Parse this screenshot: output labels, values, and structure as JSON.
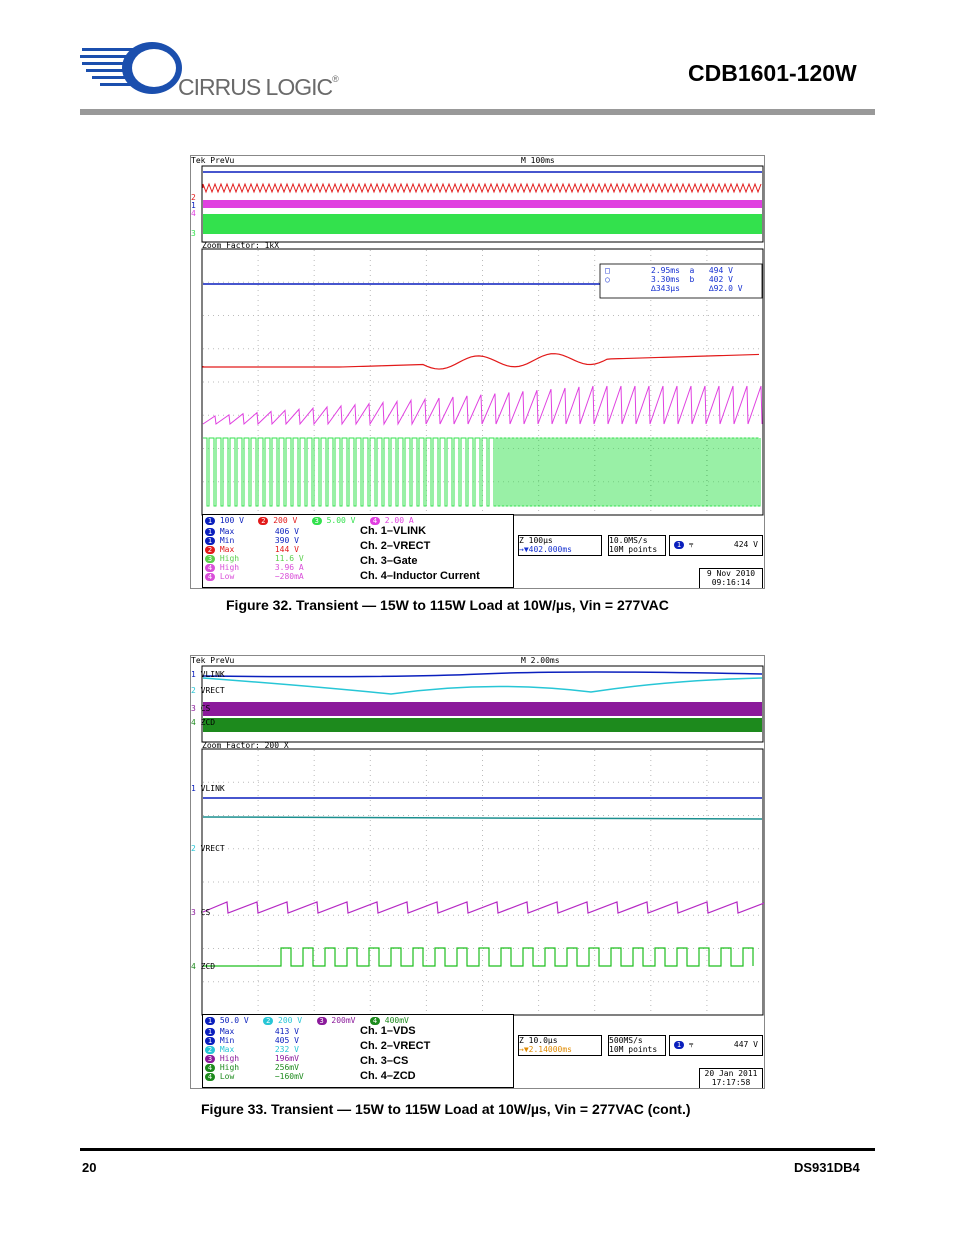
{
  "header": {
    "brand": "CIRRUS LOGIC",
    "brand_mark": "®",
    "doc_title": "CDB1601-120W"
  },
  "fig32": {
    "top_left": "Tek PreVu",
    "top_mid": "M 100ms",
    "zoom": "Zoom Factor: 1kX",
    "cursor": {
      "t1": "2.95ms",
      "t2": "3.30ms",
      "dt": "∆343µs",
      "v1": "494 V",
      "v2": "402 V",
      "dv": "∆92.0 V",
      "ma": "a",
      "mb": "b"
    },
    "ch_labels": [
      "2",
      "1",
      "4",
      "3"
    ],
    "scales": [
      "100 V",
      "200 V",
      "5.00 V",
      "2.00 A"
    ],
    "meas": [
      {
        "ch": "1",
        "name": "Max",
        "val": "406 V",
        "color": "#0a1fbd"
      },
      {
        "ch": "1",
        "name": "Min",
        "val": "390 V",
        "color": "#0a1fbd"
      },
      {
        "ch": "2",
        "name": "Max",
        "val": "144 V",
        "color": "#e21a1a"
      },
      {
        "ch": "3",
        "name": "High",
        "val": "11.6 V",
        "color": "#5ccf4d"
      },
      {
        "ch": "4",
        "name": "High",
        "val": "3.96 A",
        "color": "#d94fd9"
      },
      {
        "ch": "4",
        "name": "Low",
        "val": "−280mA",
        "color": "#d94fd9"
      }
    ],
    "legend": [
      "Ch. 1–VLINK",
      "Ch. 2–VRECT",
      "Ch. 3–Gate",
      "Ch. 4–Inductor Current"
    ],
    "zoom_box": [
      "Z 100µs",
      "→▼402.000ms"
    ],
    "rate_box": [
      "10.0MS/s",
      "10M points"
    ],
    "trig_box": [
      "1",
      "⫧",
      "424 V"
    ],
    "date": [
      "9 Nov 2010",
      "09:16:14"
    ],
    "caption": "Figure 32.  Transient — 15W to 115W Load at 10W/µs, Vin = 277VAC"
  },
  "fig33": {
    "top_left": "Tek PreVu",
    "top_mid": "M 2.00ms",
    "zoom": "Zoom Factor: 200 X",
    "ch_names": [
      "VLINK",
      "VRECT",
      "CS",
      "ZCD"
    ],
    "ch_nums": [
      "1",
      "2",
      "3",
      "4"
    ],
    "scales": [
      "50.0 V",
      "200 V",
      "200mV",
      "400mV"
    ],
    "meas": [
      {
        "ch": "1",
        "name": "Max",
        "val": "413 V",
        "color": "#0a1fbd"
      },
      {
        "ch": "1",
        "name": "Min",
        "val": "405 V",
        "color": "#0a1fbd"
      },
      {
        "ch": "2",
        "name": "Max",
        "val": "232 V",
        "color": "#27c6d6"
      },
      {
        "ch": "3",
        "name": "High",
        "val": "196mV",
        "color": "#8b1a9b"
      },
      {
        "ch": "4",
        "name": "High",
        "val": "256mV",
        "color": "#1d8a1d"
      },
      {
        "ch": "4",
        "name": "Low",
        "val": "−160mV",
        "color": "#1d8a1d"
      }
    ],
    "legend": [
      "Ch. 1–VDS",
      "Ch. 2–VRECT",
      "Ch. 3–CS",
      "Ch. 4–ZCD"
    ],
    "zoom_box": [
      "Z 10.0µs",
      "→▼2.14000ms"
    ],
    "rate_box": [
      "500MS/s",
      "10M points"
    ],
    "trig_box": [
      "1",
      "⫧",
      "447 V"
    ],
    "date": [
      "20 Jan 2011",
      "17:17:58"
    ],
    "caption": "Figure 33.  Transient — 15W to 115W Load at 10W/µs, Vin = 277VAC (cont.)"
  },
  "footer": {
    "page": "20",
    "doc_id": "DS931DB4"
  },
  "colors": {
    "ch1": "#0a1fbd",
    "ch2": "#e21a1a",
    "ch3": "#33e14d",
    "ch4": "#e040e0"
  }
}
